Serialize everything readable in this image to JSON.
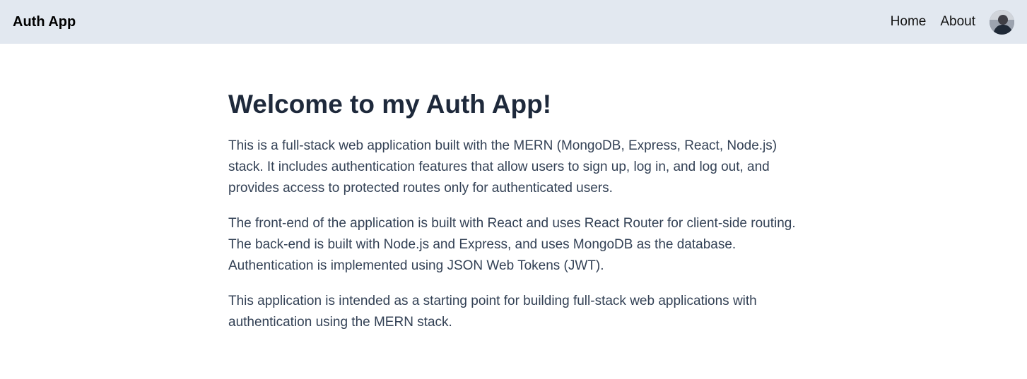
{
  "header": {
    "brand": "Auth App",
    "nav": [
      {
        "label": "Home"
      },
      {
        "label": "About"
      }
    ],
    "avatar_icon": "user-avatar"
  },
  "main": {
    "title": "Welcome to my Auth App!",
    "paragraphs": [
      "This is a full-stack web application built with the MERN (MongoDB, Express, React, Node.js) stack. It includes authentication features that allow users to sign up, log in, and log out, and provides access to protected routes only for authenticated users.",
      "The front-end of the application is built with React and uses React Router for client-side routing. The back-end is built with Node.js and Express, and uses MongoDB as the database. Authentication is implemented using JSON Web Tokens (JWT).",
      "This application is intended as a starting point for building full-stack web applications with authentication using the MERN stack."
    ]
  },
  "colors": {
    "header_bg": "#e2e8f0",
    "title": "#1e293b",
    "body_text": "#334155"
  }
}
